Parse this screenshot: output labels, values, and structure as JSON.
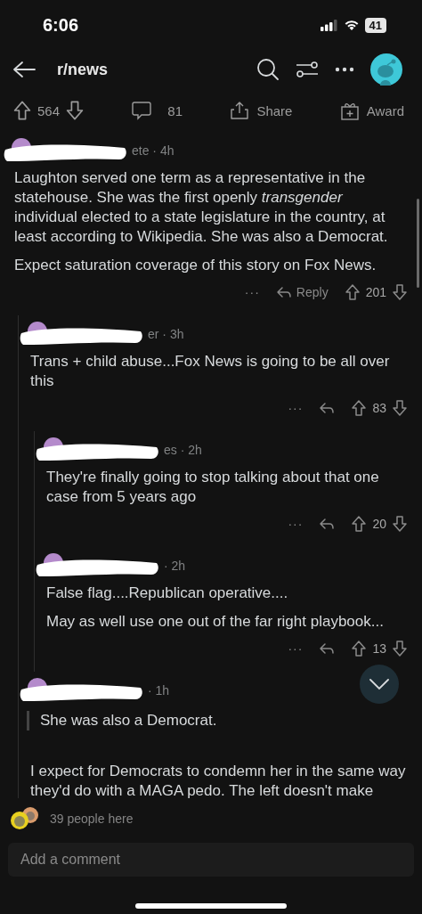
{
  "status_bar": {
    "time": "6:06",
    "battery": "41"
  },
  "header": {
    "title": "r/news"
  },
  "post_actions": {
    "upvotes": "564",
    "comments": "81",
    "share": "Share",
    "award": "Award"
  },
  "comments": [
    {
      "meta": "ete · 4h",
      "body": [
        {
          "kind": "text",
          "text": "Laughton served one term as a representative in the statehouse.  She was the first openly *transgender* individual elected to a state legislature in the country, at least according to Wikipedia.  She was also a Democrat."
        },
        {
          "kind": "text",
          "text": "Expect saturation coverage of this story on Fox News."
        }
      ],
      "more": "···",
      "reply_label": "Reply",
      "score": "201",
      "children": [
        {
          "meta": "er · 3h",
          "body": [
            {
              "kind": "text",
              "text": "Trans + child abuse...Fox News is going to be all over this"
            }
          ],
          "more": "···",
          "score": "83",
          "children": [
            {
              "meta": "es · 2h",
              "body": [
                {
                  "kind": "text",
                  "text": "They're finally going to stop talking about that one case from 5 years ago"
                }
              ],
              "more": "···",
              "score": "20"
            },
            {
              "meta": "· 2h",
              "body": [
                {
                  "kind": "text",
                  "text": "False flag....Republican operative...."
                },
                {
                  "kind": "text",
                  "text": "May as well use one out of the far right playbook..."
                }
              ],
              "more": "···",
              "score": "13"
            }
          ]
        },
        {
          "meta": "· 1h",
          "body": [
            {
              "kind": "quote",
              "text": "She was also a Democrat."
            },
            {
              "kind": "text",
              "text": "I expect for Democrats to condemn her in the same way they'd do with a MAGA pedo. The left doesn't make"
            }
          ]
        }
      ]
    }
  ],
  "presence": {
    "text": "39 people here"
  },
  "comment_field": {
    "placeholder": "Add a comment"
  }
}
